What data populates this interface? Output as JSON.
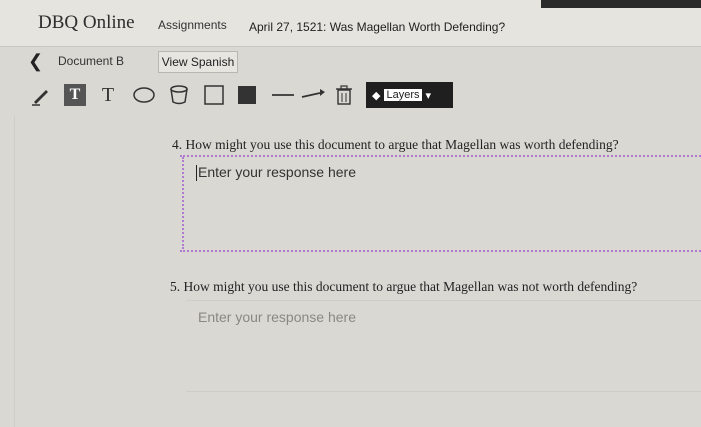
{
  "header": {
    "app_title": "DBQ Online",
    "nav_assignments": "Assignments",
    "document_title": "April 27, 1521: Was Magellan Worth Defending?"
  },
  "subheader": {
    "document_label": "Document B",
    "view_spanish_label": "View Spanish"
  },
  "toolbar": {
    "tools": [
      "pencil-icon",
      "text-box-icon",
      "text-icon",
      "ellipse-icon",
      "bucket-icon",
      "square-outline-icon",
      "square-filled-icon",
      "line-icon",
      "arrow-icon",
      "trash-icon"
    ],
    "layers_label": "Layers"
  },
  "questions": [
    {
      "text": "4. How might you use this document to argue that Magellan was worth defending?",
      "response_placeholder": "Enter your response here"
    },
    {
      "text": "5. How might you use this document to argue that Magellan was not worth defending?",
      "response_placeholder": "Enter your response here"
    }
  ]
}
